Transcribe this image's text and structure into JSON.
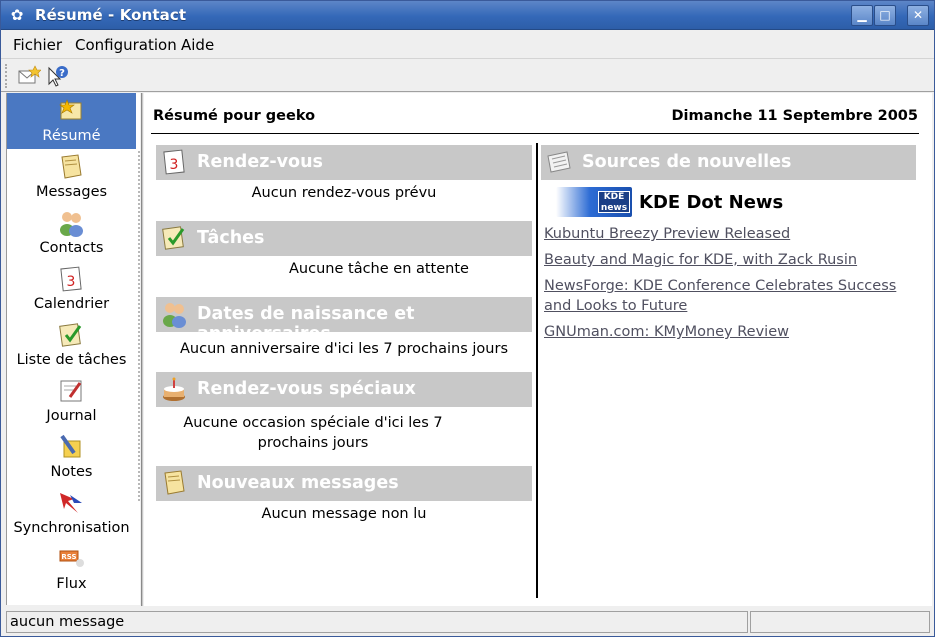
{
  "window": {
    "title": "Résumé - Kontact",
    "icon": "kde-gear-icon",
    "controls": [
      "minimize-icon",
      "maximize-icon",
      "close-icon"
    ]
  },
  "menubar": {
    "items": [
      {
        "label": "Fichier"
      },
      {
        "label": "Configuration"
      },
      {
        "label": "Aide"
      }
    ]
  },
  "toolbar": {
    "buttons": [
      {
        "icon": "new-mail-icon"
      },
      {
        "icon": "whats-this-icon"
      }
    ]
  },
  "sidebar": {
    "items": [
      {
        "label": "Résumé",
        "icon": "summary-star-icon",
        "active": true
      },
      {
        "label": "Messages",
        "icon": "mail-icon"
      },
      {
        "label": "Contacts",
        "icon": "contacts-people-icon"
      },
      {
        "label": "Calendrier",
        "icon": "calendar-icon"
      },
      {
        "label": "Liste de tâches",
        "icon": "todo-checklist-icon"
      },
      {
        "label": "Journal",
        "icon": "journal-icon"
      },
      {
        "label": "Notes",
        "icon": "notes-icon"
      },
      {
        "label": "Synchronisation",
        "icon": "sync-icon"
      },
      {
        "label": "Flux",
        "icon": "rss-feed-icon"
      }
    ]
  },
  "summary": {
    "title": "Résumé pour geeko",
    "date": "Dimanche 11 Septembre 2005",
    "sections": [
      {
        "title": "Rendez-vous",
        "icon": "calendar-icon",
        "body": "Aucun rendez-vous prévu"
      },
      {
        "title": "Tâches",
        "icon": "todo-checklist-icon",
        "body": "Aucune tâche en attente"
      },
      {
        "title": "Dates de naissance et anniversaires",
        "icon": "contacts-people-icon",
        "body": "Aucun anniversaire d'ici les 7 prochains jours"
      },
      {
        "title": "Rendez-vous spéciaux",
        "icon": "birthday-cake-icon",
        "body_line1": "Aucune occasion spéciale d'ici les 7",
        "body_line2": "prochains jours"
      },
      {
        "title": "Nouveaux messages",
        "icon": "mail-icon",
        "body": "Aucun message non lu"
      }
    ],
    "news": {
      "title": "Sources de nouvelles",
      "icon": "newspaper-icon",
      "feed_name": "KDE Dot News",
      "feed_logo_text": "KDE news",
      "links": [
        {
          "text": "Kubuntu Breezy Preview Released"
        },
        {
          "text": "Beauty and Magic for KDE, with Zack Rusin"
        },
        {
          "text_line1": "NewsForge: KDE Conference Celebrates Success",
          "text_line2": "and Looks to Future"
        },
        {
          "text": "GNUman.com: KMyMoney Review"
        }
      ]
    }
  },
  "statusbar": {
    "message": "aucun message"
  },
  "colors": {
    "titlebar": "#3468b8",
    "sidebar_active": "#4a78c2",
    "section_header": "#c8c8c8",
    "link": "#505060"
  }
}
